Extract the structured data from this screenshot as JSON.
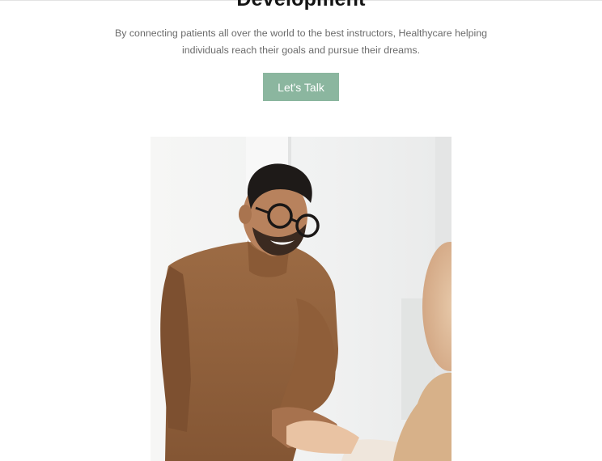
{
  "hero": {
    "heading": "Development",
    "subtitle": "By connecting patients all over the world to the best instructors, Healthycare helping individuals reach their goals and pursue their dreams.",
    "cta_label": "Let's Talk"
  },
  "colors": {
    "accent": "#8bb69f",
    "heading": "#141414",
    "body_text": "#6b6b6b",
    "background": "#ffffff"
  },
  "photo": {
    "subject": "smiling man in glasses and brown sweater shaking hands"
  }
}
